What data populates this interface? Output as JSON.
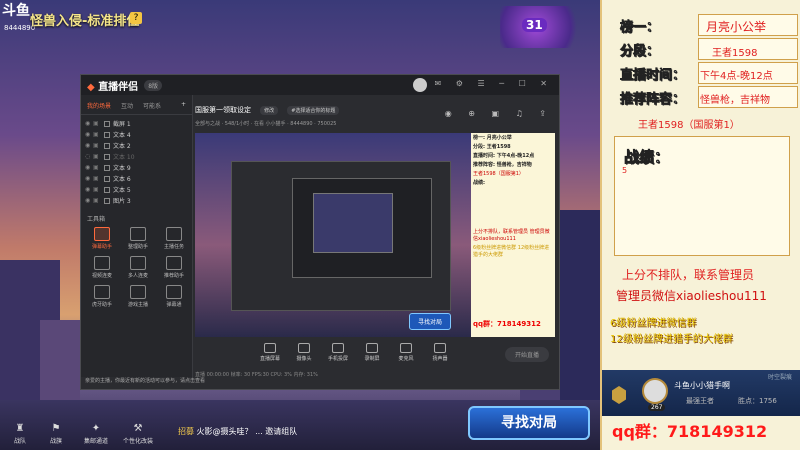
{
  "game": {
    "title": "怪兽入侵-标准排位",
    "room_id": "8444890",
    "logo": "斗鱼",
    "level_badge": "31",
    "find_match": "寻找对局",
    "bottom_items": [
      "战队",
      "战旗",
      "集邮通道",
      "个性化改装"
    ],
    "barrage_user": "招募",
    "barrage_text": "火影@摄头哇？ ... 邀请组队"
  },
  "app": {
    "name": "直播伴侣",
    "badge": "8版",
    "tabs": [
      "我的场景",
      "互动",
      "可能系"
    ],
    "layers": [
      {
        "label": "截屏 1",
        "dim": false
      },
      {
        "label": "文本 4",
        "dim": false
      },
      {
        "label": "文本 2",
        "dim": false
      },
      {
        "label": "文本 10",
        "dim": true
      },
      {
        "label": "文本 9",
        "dim": false
      },
      {
        "label": "文本 6",
        "dim": false
      },
      {
        "label": "文本 5",
        "dim": false
      },
      {
        "label": "图片 3",
        "dim": false
      }
    ],
    "tools_label": "工具箱",
    "tools": [
      "弹幕助手",
      "整理助手",
      "主播任务",
      "视频连麦",
      "多人连麦",
      "推荐助手",
      "虎牙助手",
      "游戏主播",
      "弹幕通"
    ],
    "stream_title": "国服第一领取设定",
    "chips": [
      "修改",
      "#选择适合你的标题"
    ],
    "sub_info": "全部与之战 · 548/1小时 · 在看 小小猫手 · 8444890 · 750025",
    "controls": [
      "直播屏幕",
      "摄像头",
      "手机投屏",
      "录制屏",
      "麦克风",
      "扬声器"
    ],
    "live_button": "开始直播",
    "status_line": "直播 00:00:00   帧率: 30   FPS:30   CPU: 3%   内存: 31%",
    "notice": "亲爱的主播，你最近有新的活动可以参与，请点击查看"
  },
  "nested_panel": {
    "lines": [
      "榜一: 月亮小公举",
      "分段: 王者1598",
      "直播时间: 下午4点-晚12点",
      "推荐阵容: 怪兽枪，吉祥物",
      "王者1598（国服第1）",
      "战绩:"
    ],
    "recruit": "上分不排队，联系管理员 管理员微信xiaolieshou111",
    "fans": "6级粉丝牌进微信群 12级粉丝牌进猎手的大佬群",
    "qq": "qq群：718149312",
    "find_match": "寻找对局"
  },
  "panel": {
    "rank1_key": "榜一：",
    "rank1_val": "月亮小公举",
    "tier_key": "分段：",
    "tier_val": "王者1598",
    "time_key": "直播时间：",
    "time_val": "下午4点-晚12点",
    "lineup_key": "推荐阵容：",
    "lineup_val": "怪兽枪，吉祥物",
    "server_rank": "王者1598（国服第1）",
    "record_key": "战绩：",
    "record_val": "5",
    "recruit1": "上分不排队，联系管理员",
    "recruit2": "管理员微信xiaolieshou111",
    "fans1": "6级粉丝牌进微信群",
    "fans2": "12级粉丝牌进猎手的大佬群",
    "profile_name": "斗鱼小小猎手啊",
    "profile_rank": "最强王者",
    "profile_wins_label": "胜点：",
    "profile_wins": "1756",
    "profile_level": "267",
    "profile_season": "时空裂痕",
    "qq": "qq群：718149312"
  }
}
